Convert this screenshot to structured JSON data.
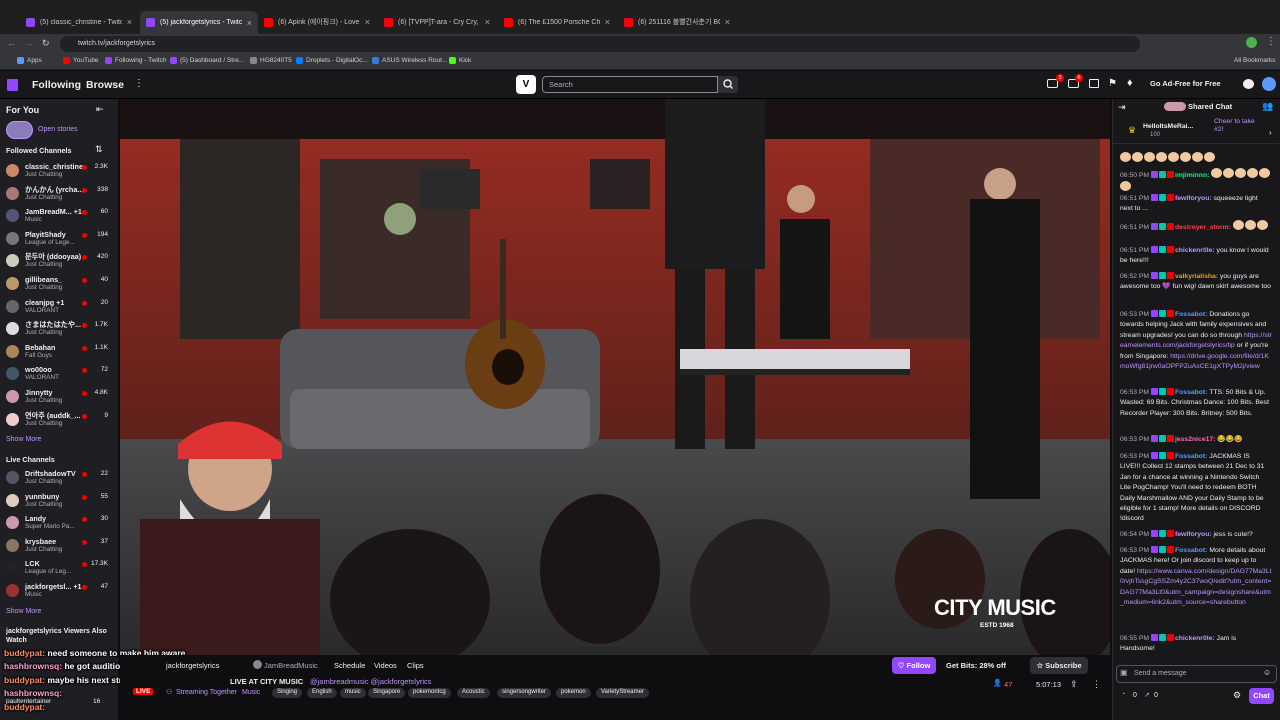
{
  "browser": {
    "tabs": [
      {
        "title": "(5) classic_christine - Twitch",
        "color": "#9147ff"
      },
      {
        "title": "(5) jackforgetslyrics - Twitch",
        "color": "#9147ff"
      },
      {
        "title": "(6) Apink (에이핑크) - Love Me",
        "color": "#ff0000"
      },
      {
        "title": "(6) [TVPP]T-ara - Cry Cry, 티아",
        "color": "#ff0000"
      },
      {
        "title": "(6) The £1500 Porsche Challenge",
        "color": "#ff0000"
      },
      {
        "title": "(6) 251116 볼빨간사춘기 BOL4",
        "color": "#ff0000"
      }
    ],
    "url": "twitch.tv/jackforgetslyrics",
    "bookmarks": [
      "Apps",
      "YouTube",
      "Following - Twitch",
      "(5) Dashboard / Stre...",
      "HG8240T5",
      "Droplets - DigitalOc...",
      "ASUS Wireless Rout...",
      "Kick"
    ],
    "all_bookmarks": "All Bookmarks"
  },
  "topnav": {
    "following": "Following",
    "browse": "Browse",
    "search_placeholder": "Search",
    "adfree": "Go Ad-Free for Free",
    "notif1": "3",
    "notif2": "6"
  },
  "sidebar": {
    "for_you": "For You",
    "open_stories": "Open stories",
    "followed_title": "Followed Channels",
    "followed": [
      {
        "name": "classic_christine",
        "game": "Just Chatting",
        "viewers": "2.3K",
        "color": "#c86"
      },
      {
        "name": "かんかん (yrcha...",
        "game": "Just Chatting",
        "viewers": "338",
        "color": "#a77"
      },
      {
        "name": "JamBreadM... +1",
        "game": "Music",
        "viewers": "60",
        "color": "#557"
      },
      {
        "name": "PlayitShady",
        "game": "League of Lege...",
        "viewers": "194",
        "color": "#777"
      },
      {
        "name": "문두아 (ddooyaa)",
        "game": "Just Chatting",
        "viewers": "420",
        "color": "#ccb"
      },
      {
        "name": "gillibeans_",
        "game": "Just Chatting",
        "viewers": "40",
        "color": "#b96"
      },
      {
        "name": "cleanjpg +1",
        "game": "VALORANT",
        "viewers": "20",
        "color": "#666"
      },
      {
        "name": "さまはたはたや...",
        "game": "Just Chatting",
        "viewers": "1.7K",
        "color": "#ddd"
      },
      {
        "name": "Bebahan",
        "game": "Fall Guys",
        "viewers": "1.1K",
        "color": "#a85"
      },
      {
        "name": "wo00oo",
        "game": "VALORANT",
        "viewers": "72",
        "color": "#456"
      },
      {
        "name": "Jinnytty",
        "game": "Just Chatting",
        "viewers": "4.8K",
        "color": "#c9a"
      },
      {
        "name": "연아주 (auddk_...",
        "game": "Just Chatting",
        "viewers": "9",
        "color": "#ecc"
      }
    ],
    "show_more_1": "Show More",
    "live_title": "Live Channels",
    "live": [
      {
        "name": "DriftshadowTV",
        "game": "Just Chatting",
        "viewers": "22",
        "color": "#556"
      },
      {
        "name": "yunnbuny",
        "game": "Just Chatting",
        "viewers": "55",
        "color": "#dcb"
      },
      {
        "name": "Landy",
        "game": "Super Mario Pa...",
        "viewers": "30",
        "color": "#c9a"
      },
      {
        "name": "krysbaee",
        "game": "Just Chatting",
        "viewers": "37",
        "color": "#876"
      },
      {
        "name": "LCK",
        "game": "League of Leg...",
        "viewers": "17.3K",
        "color": "#222"
      },
      {
        "name": "jackforgetsl... +1",
        "game": "Music",
        "viewers": "47",
        "color": "#933"
      }
    ],
    "show_more_2": "Show More",
    "also_watch": "jackforgetslyrics Viewers Also Watch",
    "bottom_name": "paultentertainer",
    "bottom_viewers": "16"
  },
  "video": {
    "watermark": "CITY MUSIC",
    "watermark_sub": "ESTD 1968",
    "overlay_lines": [
      {
        "user": "buddypat:",
        "text": "need someone to make him aware"
      },
      {
        "user": "hashbrownsq:",
        "text": "he got audition for busking before what"
      },
      {
        "user": "buddypat:",
        "text": "maybe his next stream i enlighten him"
      },
      {
        "user": "hashbrownsq:",
        "text": ""
      },
      {
        "user": "buddypat:",
        "text": ""
      }
    ]
  },
  "stream": {
    "streamer": "jackforgetslyrics",
    "with": "JamBreadMusic",
    "title": "LIVE AT CITY MUSIC",
    "mentions": "@jambreadmusic @jackforgetslyrics",
    "live": "LIVE",
    "together": "Streaming Together",
    "category": "Music",
    "schedule": "Schedule",
    "videos": "Videos",
    "clips": "Clips",
    "follow": "Follow",
    "bits": "Get Bits: 28% off",
    "subscribe": "Subscribe",
    "viewers": "47",
    "uptime": "5:07:13",
    "tags": [
      "Singing",
      "English",
      "music",
      "Singapore",
      "pokemontcg",
      "Acoustic",
      "singersongwriter",
      "pokemon",
      "VarietyStreamer"
    ]
  },
  "chat": {
    "title": "Shared Chat",
    "pinned_user": "HelloItsMeRai...",
    "pinned_amount": "100",
    "cheer": "Cheer to take #2!",
    "messages": [
      {
        "time": "",
        "user": "",
        "text": "",
        "claps": 8,
        "ucolor": "#fff"
      },
      {
        "time": "06:50 PM",
        "user": "imjiminnn:",
        "text": "",
        "claps": 6,
        "ucolor": "#00ff7f"
      },
      {
        "time": "06:51 PM",
        "user": "fewlforyou:",
        "text": "squeeeze tight next to ...",
        "claps": 0,
        "ucolor": "#bf94ff"
      },
      {
        "time": "06:51 PM",
        "user": "destroyer_storm:",
        "text": "",
        "claps": 3,
        "ucolor": "#ff4040"
      },
      {
        "time": "06:51 PM",
        "user": "chickenr0le:",
        "text": "you know I would be here!!!",
        "claps": 0,
        "ucolor": "#bf94ff"
      },
      {
        "time": "06:52 PM",
        "user": "valkyrialisha:",
        "text": "you guys are awesome too 💜 fun wig! dawn skirt awesome too",
        "claps": 0,
        "ucolor": "#daa520"
      },
      {
        "time": "06:53 PM",
        "user": "Fossabot:",
        "text": "Donations go towards helping Jack with family expensives and stream upgrades! you can do so through https://streamelements.com/jackforgetslyrics/tip or if you're from Singapore: https://drive.google.com/file/d/1KmoWfg81jrw0aOPFPZuAsCE1gXTPyM2j/view",
        "claps": 0,
        "ucolor": "#5b99ff"
      },
      {
        "time": "06:53 PM",
        "user": "Fossabot:",
        "text": "TTS: 50 Bits & Up. Wasted: 69 Bits. Christmas Dance: 100 Bits. Best Recorder Player: 300 Bits. Britney: 500 Bits.",
        "claps": 0,
        "ucolor": "#5b99ff"
      },
      {
        "time": "06:53 PM",
        "user": "jess2nice17:",
        "text": "😂😂😂",
        "claps": 0,
        "ucolor": "#ff69b4"
      },
      {
        "time": "06:53 PM",
        "user": "Fossabot:",
        "text": "JACKMAS IS LIVE!!! Collect 12 stamps between 21 Dec to 31 Jan for a chance at winning a Nintendo Switch Lite PogChamp! You'll need to redeem BOTH Daily Marshmallow AND your Daily Stamp to be eligible for 1 stamp! More details on DISCORD !discord",
        "claps": 0,
        "ucolor": "#5b99ff"
      },
      {
        "time": "06:54 PM",
        "user": "fewlforyou:",
        "text": "jess is cute!?",
        "claps": 0,
        "ucolor": "#bf94ff"
      },
      {
        "time": "06:53 PM",
        "user": "Fossabot:",
        "text": "More details about JACKMAS here! Or join discord to keep up to date! https://www.canva.com/design/DAG77Ma3Lt0/vjhTssgCgSSZm4y2C37woQ/edit?utm_content=DAG77Ma3Lt0&utm_campaign=designshare&utm_medium=link2&utm_source=sharebutton",
        "claps": 0,
        "ucolor": "#5b99ff"
      },
      {
        "time": "06:55 PM",
        "user": "chickenr0le:",
        "text": "Jam is Handsome!",
        "claps": 0,
        "ucolor": "#bf94ff"
      }
    ],
    "input_placeholder": "Send a message",
    "points_a": "0",
    "points_b": "0",
    "chat_button": "Chat"
  }
}
